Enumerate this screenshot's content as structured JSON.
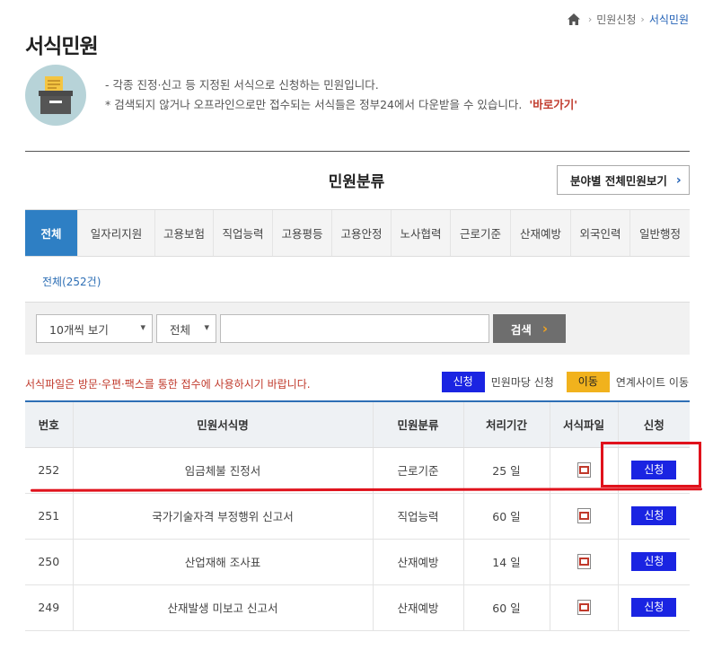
{
  "breadcrumb": {
    "home_icon": "home-icon",
    "parent": "민원신청",
    "current": "서식민원"
  },
  "page_title": "서식민원",
  "intro": {
    "icon": "document-tray-icon",
    "line1": "- 각종 진정·신고 등 지정된 서식으로 신청하는 민원입니다.",
    "line2": "* 검색되지 않거나 오프라인으로만 접수되는 서식들은 정부24에서 다운받을 수 있습니다.",
    "link": "'바로가기'"
  },
  "category": {
    "title": "민원분류",
    "all_button": "분야별 전체민원보기"
  },
  "tabs": [
    {
      "label": "전체",
      "active": true
    },
    {
      "label": "일자리지원"
    },
    {
      "label": "고용보험"
    },
    {
      "label": "직업능력"
    },
    {
      "label": "고용평등"
    },
    {
      "label": "고용안정"
    },
    {
      "label": "노사협력"
    },
    {
      "label": "근로기준"
    },
    {
      "label": "산재예방"
    },
    {
      "label": "외국인력"
    },
    {
      "label": "일반행정"
    }
  ],
  "count_label": "전체(252건)",
  "search": {
    "per_page": "10개씩 보기",
    "category": "전체",
    "query": "",
    "button": "검색"
  },
  "notice": "서식파일은 방문·우편·팩스를 통한 접수에 사용하시기 바랍니다.",
  "legend": {
    "apply_badge": "신청",
    "apply_text": "민원마당 신청",
    "move_badge": "이동",
    "move_text": "연계사이트 이동"
  },
  "table": {
    "headers": [
      "번호",
      "민원서식명",
      "민원분류",
      "처리기간",
      "서식파일",
      "신청"
    ],
    "rows": [
      {
        "no": "252",
        "name": "임금체불 진정서",
        "category": "근로기준",
        "period": "25 일",
        "apply": "신청"
      },
      {
        "no": "251",
        "name": "국가기술자격 부정행위 신고서",
        "category": "직업능력",
        "period": "60 일",
        "apply": "신청"
      },
      {
        "no": "250",
        "name": "산업재해 조사표",
        "category": "산재예방",
        "period": "14 일",
        "apply": "신청"
      },
      {
        "no": "249",
        "name": "산재발생 미보고 신고서",
        "category": "산재예방",
        "period": "60 일",
        "apply": "신청"
      }
    ]
  },
  "colors": {
    "accent": "#2e7fc4",
    "apply": "#1a24e2",
    "move": "#f1b21d",
    "highlight": "#e0121c",
    "notice": "#c0392b"
  }
}
